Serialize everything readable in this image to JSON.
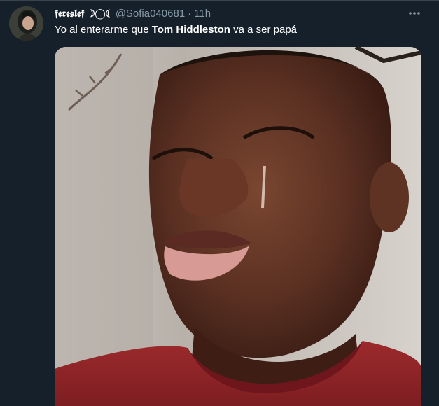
{
  "tweet": {
    "display_name": "𝖋𝖊𝖗𝖊𝖘𝖑𝖊𝖋 ☽◯☾",
    "handle": "@Sofia040681",
    "separator": "·",
    "time": "11h",
    "text_before": "Yo al enterarme que ",
    "text_bold": "Tom Hiddleston",
    "text_after": " va a ser papá"
  },
  "icons": {
    "more": "more-horizontal-icon",
    "avatar": "profile-photo"
  },
  "colors": {
    "background": "#15202b",
    "divider": "#38444d",
    "secondary_text": "#8899a6",
    "primary_text": "#ffffff"
  }
}
